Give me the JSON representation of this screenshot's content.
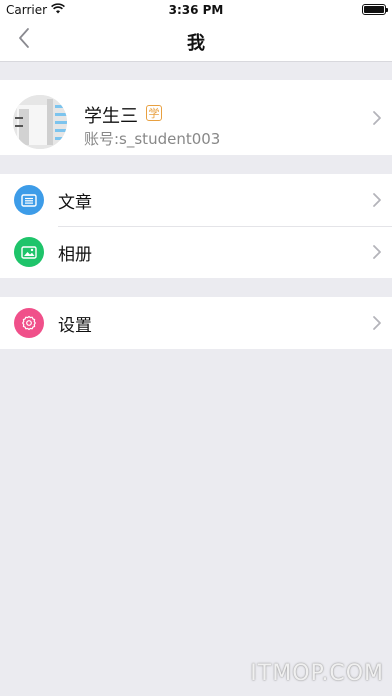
{
  "status_bar": {
    "carrier": "Carrier",
    "time": "3:36 PM"
  },
  "nav": {
    "title": "我",
    "back_icon": "chevron-left-icon"
  },
  "profile": {
    "name": "学生三",
    "role_badge": "学",
    "account": "账号:s_student003"
  },
  "menu_groups": [
    [
      {
        "label": "文章",
        "icon": "article-icon",
        "color": "#3d9ce8"
      },
      {
        "label": "相册",
        "icon": "album-icon",
        "color": "#1ec46a"
      }
    ],
    [
      {
        "label": "设置",
        "icon": "settings-icon",
        "color": "#f0508a"
      }
    ]
  ],
  "colors": {
    "background": "#ebebf0",
    "badge": "#e8a040",
    "chevron": "#b4b4ba"
  },
  "watermark": "ITMOP.COM"
}
